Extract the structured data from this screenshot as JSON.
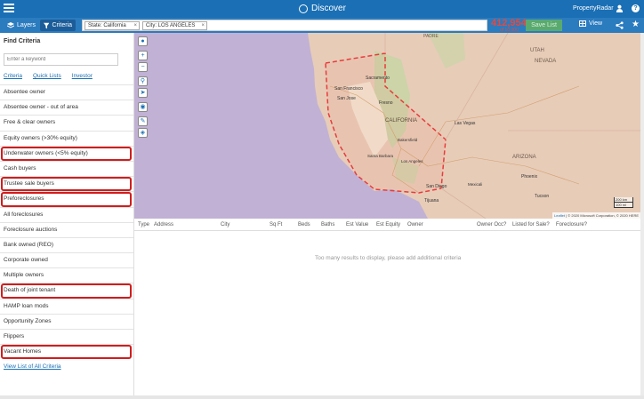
{
  "header": {
    "title": "Discover",
    "brand": "PropertyRadar",
    "icons": [
      "menu-icon",
      "globe-icon",
      "user-icon",
      "help-icon"
    ]
  },
  "subbar": {
    "layers_label": "Layers",
    "criteria_label": "Criteria",
    "chips": [
      {
        "label": "State: California"
      },
      {
        "label": "City: LOS ANGELES"
      }
    ],
    "count": "412,954",
    "count_sub": "of 10,000",
    "save_label": "Save List",
    "view_label": "View",
    "icons": [
      "share-icon",
      "star-icon"
    ]
  },
  "sidebar": {
    "heading": "Find Criteria",
    "keyword_placeholder": "Enter a keyword",
    "tabs": [
      "Criteria",
      "Quick Lists",
      "Investor"
    ],
    "items": [
      {
        "label": "Absentee owner",
        "highlighted": false
      },
      {
        "label": "Absentee owner - out of area",
        "highlighted": false
      },
      {
        "label": "Free & clear owners",
        "highlighted": false
      },
      {
        "label": "Equity owners (>30% equity)",
        "highlighted": false
      },
      {
        "label": "Underwater owners (<5% equity)",
        "highlighted": true
      },
      {
        "label": "Cash buyers",
        "highlighted": false
      },
      {
        "label": "Trustee sale buyers",
        "highlighted": true
      },
      {
        "label": "Preforeclosures",
        "highlighted": true
      },
      {
        "label": "All foreclosures",
        "highlighted": false
      },
      {
        "label": "Foreclosure auctions",
        "highlighted": false
      },
      {
        "label": "Bank owned (REO)",
        "highlighted": false
      },
      {
        "label": "Corporate owned",
        "highlighted": false
      },
      {
        "label": "Multiple owners",
        "highlighted": false
      },
      {
        "label": "Death of joint tenant",
        "highlighted": true
      },
      {
        "label": "HAMP loan mods",
        "highlighted": false
      },
      {
        "label": "Opportunity Zones",
        "highlighted": false
      },
      {
        "label": "Flippers",
        "highlighted": false
      },
      {
        "label": "Vacant Homes",
        "highlighted": true
      }
    ],
    "view_all": "View List of All Criteria"
  },
  "map": {
    "labels": [
      {
        "text": "PADRE",
        "cls": "map-label-sm"
      },
      {
        "text": "UTAH",
        "cls": "map-label-lg"
      },
      {
        "text": "NEVADA",
        "cls": "map-label-lg"
      },
      {
        "text": "Sacramento",
        "cls": "map-label-sm"
      },
      {
        "text": "San Francisco",
        "cls": "map-label-sm"
      },
      {
        "text": "San Jose",
        "cls": "map-label-sm"
      },
      {
        "text": "Fresno",
        "cls": "map-label-sm"
      },
      {
        "text": "CALIFORNIA",
        "cls": "map-label-lg"
      },
      {
        "text": "Las Vegas",
        "cls": "map-label-sm"
      },
      {
        "text": "ARIZONA",
        "cls": "map-label-lg"
      },
      {
        "text": "Phoenix",
        "cls": "map-label-sm"
      },
      {
        "text": "Tucson",
        "cls": "map-label-sm"
      },
      {
        "text": "San Diego",
        "cls": "map-label-sm"
      },
      {
        "text": "Tijuana",
        "cls": "map-label-sm"
      },
      {
        "text": "Mexicali",
        "cls": "map-label-sm"
      },
      {
        "text": "Bakersfield",
        "cls": "map-label-sm"
      },
      {
        "text": "Los Angeles",
        "cls": "map-label-sm"
      },
      {
        "text": "Santa Barbara",
        "cls": "map-label-sm"
      }
    ],
    "attribution_link": "Leaflet",
    "attribution": "| © 2020 Microsoft Corporation, © 2020 HERE",
    "scale_km": "200 km",
    "scale_mi": "100 mi",
    "tools": [
      "person-icon",
      "zoom-in-icon",
      "zoom-out-icon",
      "pin-icon",
      "locate-icon",
      "globe-icon",
      "draw-icon",
      "layers-icon"
    ]
  },
  "table": {
    "columns": [
      "Type",
      "Address",
      "City",
      "Sq Ft",
      "Beds",
      "Baths",
      "Est Value",
      "Est Equity",
      "Owner",
      "Owner Occ?",
      "Listed for Sale?",
      "Foreclosure?"
    ],
    "empty_message": "Too many results to display, please add additional criteria"
  },
  "colors": {
    "header_bg": "#1a6fb5",
    "subbar_bg": "#2b7bbf",
    "count": "#e8483c",
    "save_btn": "#5aaa6f",
    "highlight": "#d11d1d"
  }
}
